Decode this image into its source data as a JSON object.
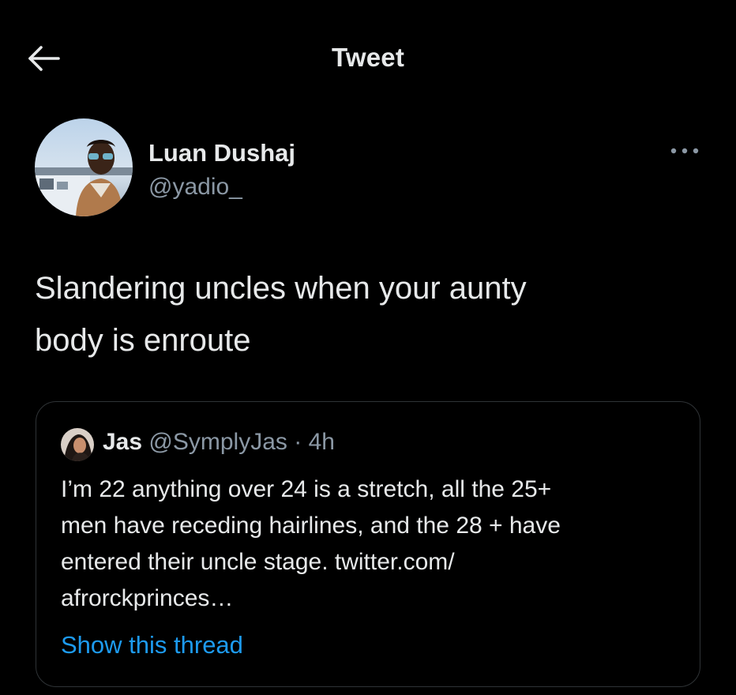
{
  "header": {
    "title": "Tweet",
    "back_icon": "arrow-left-icon"
  },
  "tweet": {
    "author": {
      "name": "Luan Dushaj",
      "handle": "@yadio_",
      "avatar_icon": "user-avatar"
    },
    "more_icon": "more-horizontal-icon",
    "text": "Slandering uncles when your aunty body is enroute",
    "text_lines": [
      "Slandering uncles when your aunty",
      "body is enroute"
    ]
  },
  "quoted_tweet": {
    "author_name": "Jas",
    "handle": "@SymplyJas",
    "separator": "·",
    "time": "4h",
    "text_lines": [
      "I’m 22 anything over 24 is a stretch, all the 25+",
      "men have receding hairlines, and  the 28 + have",
      "entered their uncle stage. twitter.com/",
      "afrorckprinces…"
    ],
    "show_thread_label": "Show this thread"
  },
  "colors": {
    "background": "#000000",
    "primary_text": "#e7e9ea",
    "secondary_text": "#8b98a5",
    "link": "#1d9bf0",
    "border": "#2f3336"
  }
}
